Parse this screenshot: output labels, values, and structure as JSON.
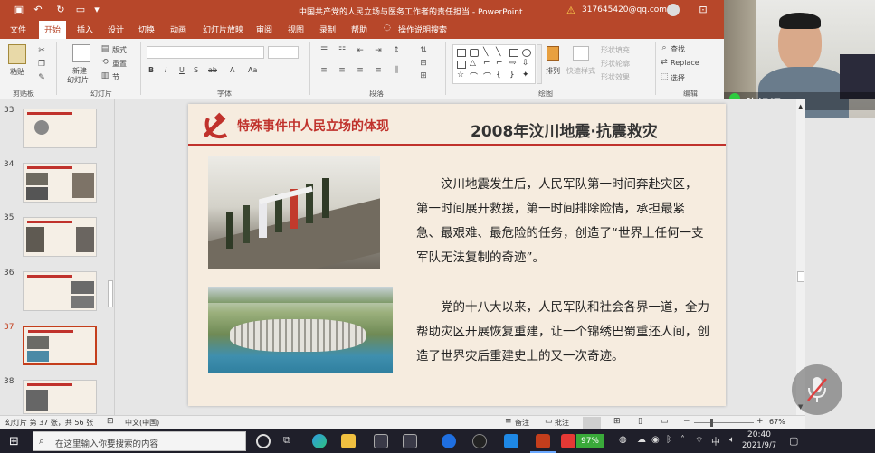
{
  "window": {
    "title": "中国共产党的人民立场与医务工作者的责任担当 - PowerPoint",
    "account": "317645420@qq.com"
  },
  "ribbon_tabs": [
    "文件",
    "开始",
    "插入",
    "设计",
    "切换",
    "动画",
    "幻灯片放映",
    "审阅",
    "视图",
    "录制",
    "帮助",
    "操作说明搜索"
  ],
  "ribbon": {
    "paste": "粘贴",
    "clipboard": "剪贴板",
    "new_slide": "新建",
    "new_slide2": "幻灯片",
    "layout": "版式",
    "reset": "重置",
    "section": "节",
    "slides_group": "幻灯片",
    "font_group": "字体",
    "paragraph_group": "段落",
    "drawing_group": "绘图",
    "editing_group": "编辑",
    "arrange": "排列",
    "quick_styles": "快速样式",
    "shape_fill": "形状填充",
    "shape_outline": "形状轮廓",
    "shape_effects": "形状效果",
    "find": "查找",
    "replace": "Replace",
    "select": "选择"
  },
  "webcam": {
    "name": "陈祖辉"
  },
  "thumbnails": [
    {
      "num": "33"
    },
    {
      "num": "34"
    },
    {
      "num": "35"
    },
    {
      "num": "36"
    },
    {
      "num": "37"
    },
    {
      "num": "38"
    }
  ],
  "slide": {
    "header_left": "特殊事件中人民立场的体现",
    "header_right": "2008年汶川地震·抗震救灾",
    "para1": "汶川地震发生后，人民军队第一时间奔赴灾区，第一时间展开救援，第一时间排除险情，承担最紧急、最艰难、最危险的任务，创造了“世界上任何一支军队无法复制的奇迹”。",
    "para2": "党的十八大以来，人民军队和社会各界一道，全力帮助灾区开展恢复重建，让一个锦绣巴蜀重还人间，创造了世界灾后重建史上的又一次奇迹。"
  },
  "status": {
    "slide_info": "幻灯片 第 37 张，共 56 张",
    "language": "中文(中国)",
    "notes": "备注",
    "comments": "批注",
    "zoom": "67%"
  },
  "taskbar": {
    "search_placeholder": "在这里输入你要搜索的内容",
    "battery": "97%",
    "ime": "中",
    "time": "20:40",
    "date": "2021/9/7"
  },
  "colors": {
    "accent": "#b7472a",
    "slide_red": "#c0322c"
  }
}
